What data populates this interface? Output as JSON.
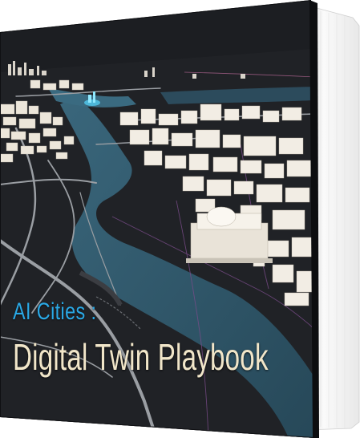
{
  "book": {
    "title_line_1": "AI Cities :",
    "title_line_2": "Digital Twin Playbook",
    "colors": {
      "cover_background": "#1a1c20",
      "water": "#2e5467",
      "roads": "#9a9ea3",
      "buildings": "#f0ebe2",
      "title_line_1": "#2aa9e6",
      "title_line_2": "#f1e6c9",
      "page_edges": "#f4f4f4"
    }
  }
}
